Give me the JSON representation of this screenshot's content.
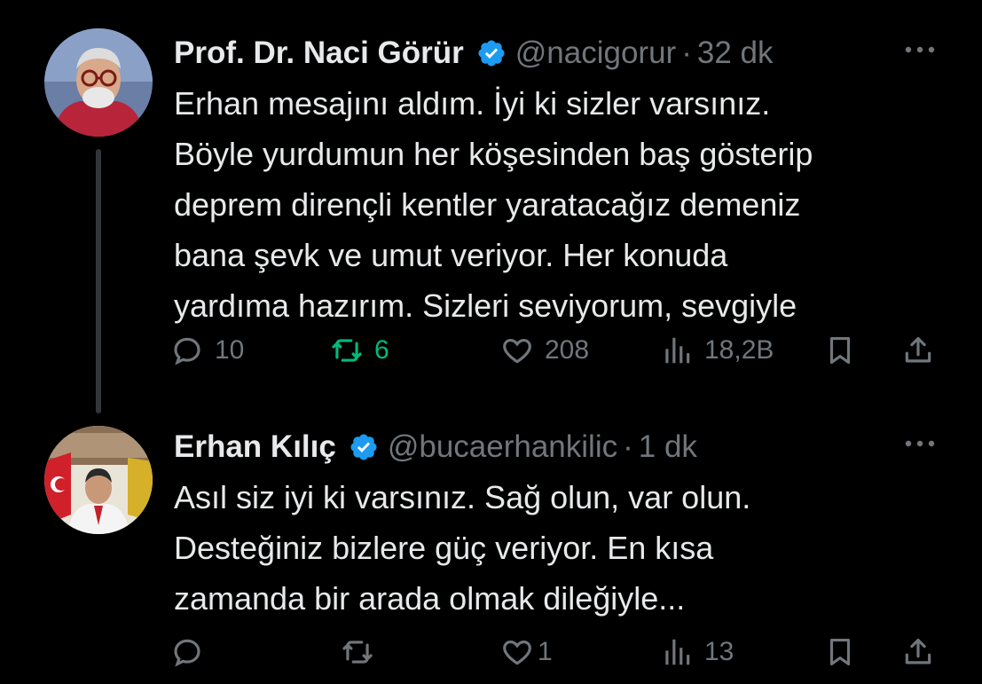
{
  "tweets": [
    {
      "author": {
        "name": "Prof. Dr. Naci Görür",
        "handle": "@nacigorur",
        "verified": true
      },
      "separator": "·",
      "time": "32 dk",
      "text": "Erhan mesajını aldım. İyi ki sizler varsınız.\nBöyle yurdumun her köşesinden baş gösterip\ndeprem dirençli kentler yaratacağız demeniz\nbana şevk ve umut veriyor.  Her konuda\nyardıma hazırım. Sizleri seviyorum, sevgiyle",
      "stats": {
        "replies": "10",
        "retweets": "6",
        "likes": "208",
        "views": "18,2B"
      },
      "retweeted_by_me": true
    },
    {
      "author": {
        "name": "Erhan Kılıç",
        "handle": "@bucaerhankilic",
        "verified": true
      },
      "separator": "·",
      "time": "1 dk",
      "text": "Asıl siz iyi ki varsınız. Sağ olun, var olun.\nDesteğiniz bizlere güç veriyor. En kısa\nzamanda bir arada olmak dileğiyle...",
      "stats": {
        "replies": "",
        "retweets": "",
        "likes": "1",
        "views": "13"
      },
      "retweeted_by_me": false
    }
  ],
  "colors": {
    "background": "#000000",
    "text": "#e7e9ea",
    "muted": "#71767b",
    "verified": "#1d9bf0",
    "retweet_active": "#00ba7c",
    "thread_line": "#333639"
  },
  "icons": {
    "reply": "reply-icon",
    "retweet": "retweet-icon",
    "like": "heart-icon",
    "views": "views-icon",
    "bookmark": "bookmark-icon",
    "share": "share-icon",
    "more": "more-icon",
    "verified": "verified-badge-icon"
  }
}
